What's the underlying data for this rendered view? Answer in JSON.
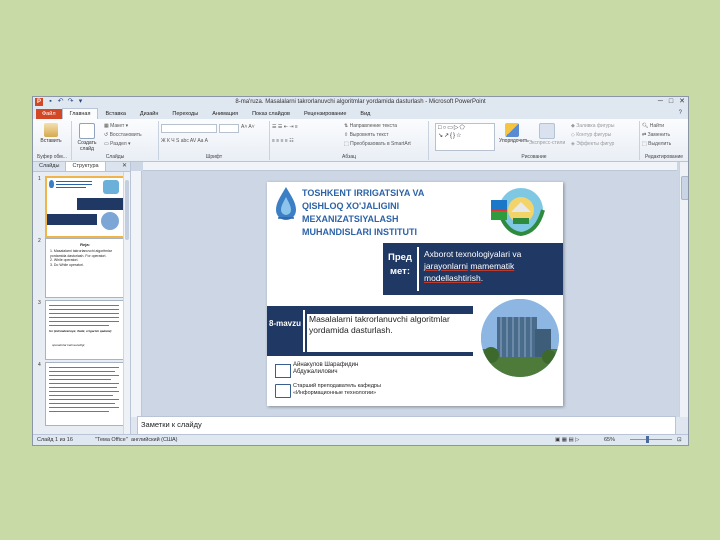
{
  "window": {
    "title": "8-ma'ruza. Masalalarni takrorlanuvchi algoritmlar yordamida dasturlash  -  Microsoft PowerPoint",
    "app_icon": "P"
  },
  "quick_access": [
    "save-icon",
    "undo-icon",
    "redo-icon",
    "customize-icon"
  ],
  "window_controls": [
    "minimize",
    "maximize",
    "close"
  ],
  "ribbon_tabs": [
    "Файл",
    "Главная",
    "Вставка",
    "Дизайн",
    "Переходы",
    "Анимация",
    "Показ слайдов",
    "Рецензирование",
    "Вид"
  ],
  "active_tab": "Главная",
  "ribbon": {
    "clipboard": {
      "paste": "Вставить",
      "label": "Буфер обм..."
    },
    "slides": {
      "new_slide": "Создать слайд",
      "layout": "Макет",
      "reset": "Восстановить",
      "section": "Раздел",
      "label": "Слайды"
    },
    "font": {
      "label": "Шрифт",
      "buttons": "Ж К Ч S abc AV Aa A"
    },
    "paragraph": {
      "text_direction": "Направление текста",
      "align_text": "Выровнять текст",
      "smartart": "Преобразовать в SmartArt",
      "label": "Абзац"
    },
    "drawing": {
      "arrange": "Упорядочить",
      "quick_styles": "Экспресс-стили",
      "shape_fill": "Заливка фигуры",
      "shape_outline": "Контур фигуры",
      "shape_effects": "Эффекты фигур",
      "label": "Рисование"
    },
    "editing": {
      "find": "Найти",
      "replace": "Заменить",
      "select": "Выделить",
      "label": "Редактирование"
    }
  },
  "panel_tabs": [
    "Слайды",
    "Структура"
  ],
  "thumbnails": [
    {
      "num": "1"
    },
    {
      "num": "2",
      "title": "Reja:",
      "lines": [
        "1. Masalalarni takrorlanuvchi algoritmlar yordamida dasturlash. For operatori.",
        "2. While operatori.",
        "3. Do While operatori."
      ]
    },
    {
      "num": "3",
      "italic": "for (initsializatsiya; ifoda; o'zgarish qadami)",
      "note": "operatorlar ketma-ketligi;"
    },
    {
      "num": "4"
    }
  ],
  "slide": {
    "institute": "TOSHKENT IRRIGATSIYA VA QISHLOQ XO'JALIGINI MEXANIZATSIYALASH MUHANDISLARI INSTITUTI",
    "predmet_label": "Пред мет:",
    "predmet_pre": "Axborot texnologiyalari va ",
    "predmet_u1": "jarayonlarni",
    "predmet_sp": " ",
    "predmet_u2": "mamematik modellashtirish",
    "predmet_post": ".",
    "mavzu_label": "8-mavzu",
    "mavzu_text": "Masalalarni takrorlanuvchi algoritmlar yordamida dasturlash.",
    "author": "Айнакулов Шарафидин Абдужалилович",
    "position": "Старший преподаватель кафедры «Информационные технологии»"
  },
  "notes_placeholder": "Заметки к слайду",
  "status": {
    "slide": "Слайд 1 из 16",
    "theme": "\"Тема Office\"",
    "language": "английский (США)",
    "zoom": "65%"
  },
  "colors": {
    "accent": "#d24726",
    "dark_blue": "#203864",
    "institute_blue": "#2c63a8"
  }
}
